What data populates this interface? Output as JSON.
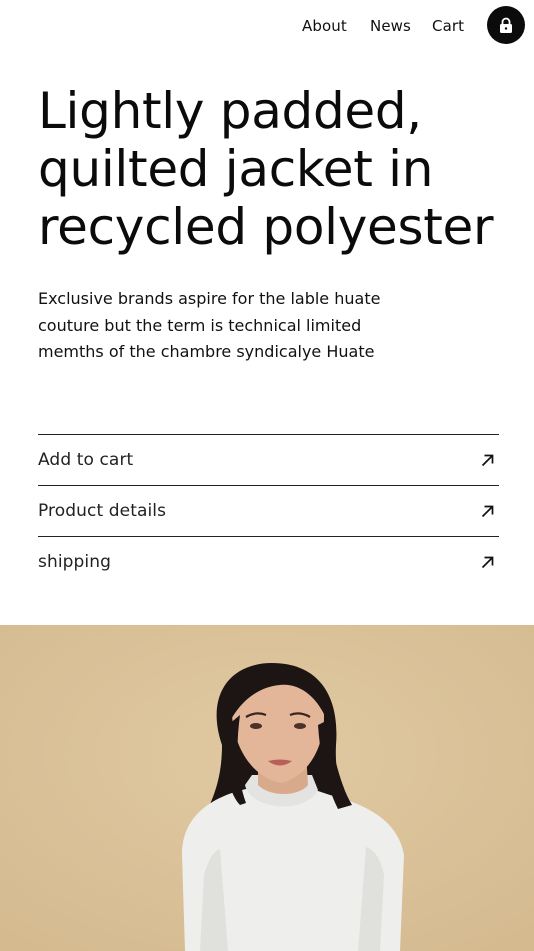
{
  "nav": {
    "links": [
      "About",
      "News",
      "Cart"
    ],
    "lock_icon": "lock-icon"
  },
  "product": {
    "title": "Lightly padded, quilted jacket in recycled polyester",
    "description": "Exclusive brands aspire for the lable huate couture but the term is technical limited memths of the chambre syndicalye Huate"
  },
  "actions": [
    {
      "label": "Add to cart",
      "icon": "arrow-up-right-icon"
    },
    {
      "label": "Product details",
      "icon": "arrow-up-right-icon"
    },
    {
      "label": "shipping",
      "icon": "arrow-up-right-icon"
    }
  ],
  "colors": {
    "background": "#ffffff",
    "text": "#0b0b0b",
    "lock_button": "#0b0b0b",
    "hero_backdrop": "#d9c095"
  }
}
